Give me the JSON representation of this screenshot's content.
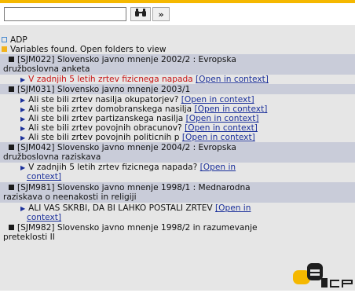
{
  "search": {
    "value": "",
    "placeholder": ""
  },
  "toolbar": {
    "find_label": "🔭",
    "next_label": "»"
  },
  "tree": {
    "root_label": "ADP",
    "status_text": "Variables found. Open folders to view",
    "groups": [
      {
        "title_line1": "[SJM022] Slovensko javno mnenje 2002/2 : Evropska",
        "title_line2": "družboslovna anketa",
        "items": [
          {
            "text": "V zadnjih 5 letih zrtev fizicnega napada",
            "link": "[Open in context]"
          }
        ]
      },
      {
        "title_line1": "[SJM031] Slovensko javno mnenje 2003/1",
        "items": [
          {
            "text": "Ali ste bili zrtev nasilja okupatorjev?",
            "link": "[Open in context]"
          },
          {
            "text": "Ali ste bili zrtev domobranskega nasilja",
            "link": "[Open in context]"
          },
          {
            "text": "Ali ste bili zrtev partizanskega nasilja",
            "link": "[Open in context]"
          },
          {
            "text": "Ali ste bili zrtev povojnih obracunov?",
            "link": "[Open in context]"
          },
          {
            "text": "Ali ste bili zrtev povojnih politicnih p",
            "link": "[Open in context]"
          }
        ]
      },
      {
        "title_line1": "[SJM042] Slovensko javno mnenje 2004/2 : Evropska",
        "title_line2": "družboslovna raziskava",
        "items": [
          {
            "text": "V zadnjih 5 letih zrtev fizicnega napada?",
            "link_part1": "[Open in",
            "link_part2": "context]"
          }
        ]
      },
      {
        "title_line1": "[SJM981] Slovensko javno mnenje 1998/1 : Mednarodna",
        "title_line2": "raziskava o neenakosti in religiji",
        "items": [
          {
            "text": "ALI VAS SKRBI, DA BI LAHKO POSTALI ZRTEV",
            "link_part1": "[Open in",
            "link_part2": "context]"
          }
        ]
      },
      {
        "title_line1": "[SJM982] Slovensko javno mnenje 1998/2 in razumevanje",
        "title_line2": "preteklosti II"
      }
    ]
  },
  "logo": {
    "text": "adp"
  },
  "colors": {
    "accent": "#f5b800",
    "link": "#1a2f9a",
    "highlight": "#c81414",
    "band": "#c9ccd9",
    "panel": "#e6e6e6"
  }
}
